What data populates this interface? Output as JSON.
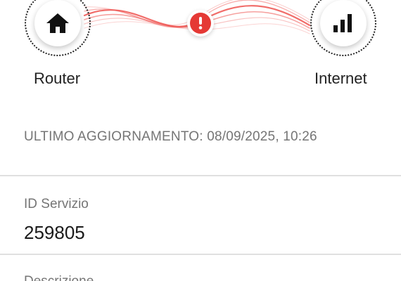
{
  "connection": {
    "router_label": "Router",
    "internet_label": "Internet",
    "router_icon": "home-icon",
    "internet_icon": "signal-bars-icon",
    "status_icon": "alert-icon",
    "error_color": "#e53935",
    "wave_color": "#ef5350"
  },
  "last_update": "ULTIMO AGGIORNAMENTO: 08/09/2025, 10:26",
  "fields": [
    {
      "label": "ID Servizio",
      "value": "259805"
    },
    {
      "label": "Descrizione"
    }
  ]
}
